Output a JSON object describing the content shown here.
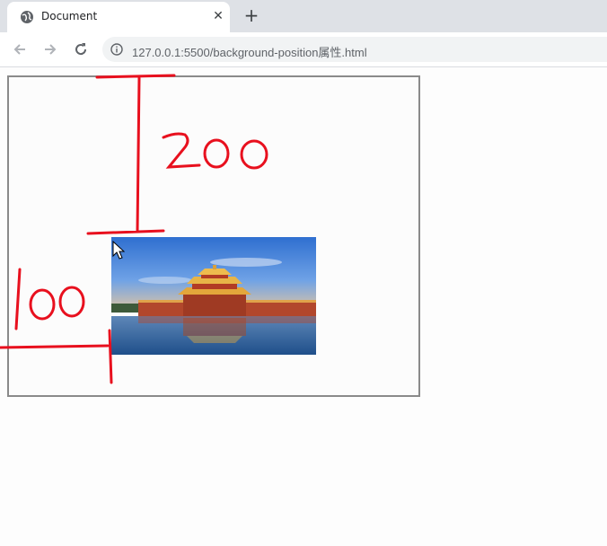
{
  "browser": {
    "tab": {
      "title": "Document",
      "favicon": "globe-icon",
      "close_glyph": "✕"
    },
    "new_tab_glyph": "+",
    "toolbar": {
      "back_icon": "arrow-left-icon",
      "forward_icon": "arrow-right-icon",
      "reload_icon": "reload-icon",
      "info_icon": "info-icon"
    },
    "address": {
      "url": "127.0.0.1:5500/background-position属性.html"
    }
  },
  "page": {
    "background_image": "forbidden-city-corner-tower-photo"
  },
  "annotations": {
    "top_offset_label": "200",
    "left_offset_label": "100",
    "color": "#e8101e"
  }
}
